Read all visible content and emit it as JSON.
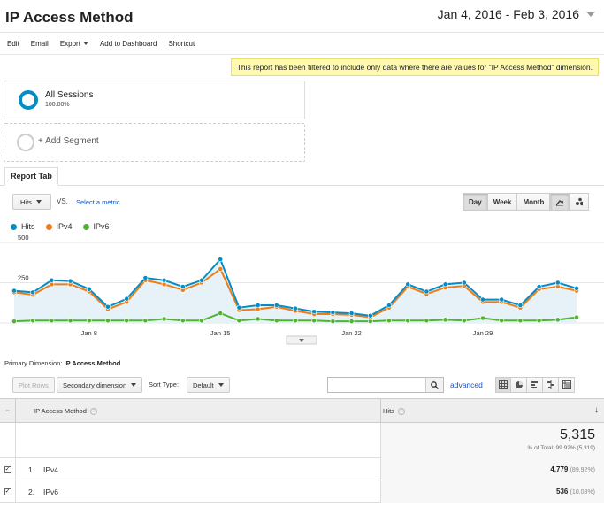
{
  "header": {
    "title": "IP Access Method",
    "date_range": "Jan 4, 2016 - Feb 3, 2016"
  },
  "toolbar": {
    "items": [
      "Edit",
      "Email",
      "Export",
      "Add to Dashboard",
      "Shortcut"
    ]
  },
  "filter_note": "This report has been filtered to include only data where there are values for \"IP Access Method\" dimension.",
  "segments": {
    "active_name": "All Sessions",
    "active_pct": "100.00%",
    "add_label": "+ Add Segment"
  },
  "tab": {
    "label": "Report Tab"
  },
  "chart_controls": {
    "metric": "Hits",
    "vs": "VS.",
    "select_metric": "Select a metric",
    "granularity": [
      "Day",
      "Week",
      "Month"
    ],
    "selected_granularity": "Day"
  },
  "colors": {
    "hits": "#058dc7",
    "ipv4": "#ed7e17",
    "ipv6": "#50b432"
  },
  "chart_data": {
    "type": "line",
    "y_tick_labels": [
      "500",
      "250"
    ],
    "ylim": [
      0,
      500
    ],
    "x_tick_labels": [
      "Jan 8",
      "Jan 15",
      "Jan 22",
      "Jan 29"
    ],
    "x_tick_index": [
      4,
      11,
      18,
      25
    ],
    "series": [
      {
        "name": "Hits",
        "values": [
          200,
          190,
          265,
          260,
          210,
          100,
          150,
          280,
          265,
          225,
          265,
          395,
          95,
          110,
          110,
          90,
          70,
          65,
          60,
          45,
          110,
          240,
          195,
          240,
          250,
          145,
          145,
          110,
          225,
          250,
          215
        ]
      },
      {
        "name": "IPv4",
        "values": [
          190,
          175,
          240,
          240,
          195,
          85,
          130,
          265,
          240,
          205,
          250,
          335,
          80,
          85,
          100,
          75,
          55,
          55,
          50,
          35,
          95,
          225,
          180,
          220,
          230,
          130,
          130,
          95,
          210,
          225,
          200
        ]
      },
      {
        "name": "IPv6",
        "values": [
          10,
          15,
          15,
          15,
          15,
          15,
          15,
          15,
          25,
          15,
          15,
          60,
          15,
          25,
          15,
          15,
          15,
          10,
          10,
          10,
          15,
          15,
          15,
          20,
          15,
          30,
          15,
          15,
          15,
          20,
          35,
          15
        ]
      }
    ]
  },
  "legend": [
    "Hits",
    "IPv4",
    "IPv6"
  ],
  "primary_dimension": {
    "label": "Primary Dimension:",
    "value": "IP Access Method"
  },
  "table_controls": {
    "plot_rows": "Plot Rows",
    "secondary_dimension": "Secondary dimension",
    "sort_type_label": "Sort Type:",
    "sort_type_value": "Default",
    "advanced": "advanced"
  },
  "table": {
    "dim_header": "IP Access Method",
    "hits_header": "Hits",
    "total_value": "5,315",
    "total_sub": "% of Total: 99.92% (5,319)",
    "rows": [
      {
        "num": "1.",
        "label": "IPv4",
        "value": "4,779",
        "pct": "(89.92%)"
      },
      {
        "num": "2.",
        "label": "IPv6",
        "value": "536",
        "pct": "(10.08%)"
      }
    ]
  }
}
